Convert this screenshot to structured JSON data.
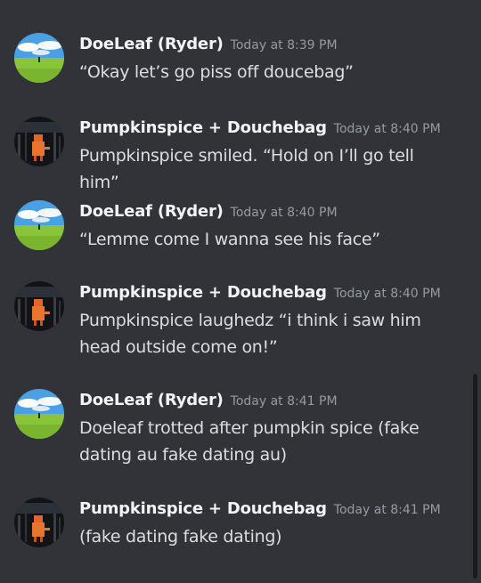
{
  "messages": [
    {
      "author": "DoeLeaf (Ryder)",
      "avatar_icon": "landscape-avatar-icon",
      "timestamp": "Today at 8:39 PM",
      "text": "“Okay let’s go piss off doucebag”"
    },
    {
      "author": "Pumpkinspice + Douchebag",
      "avatar_icon": "dark-cat-avatar-icon",
      "timestamp": "Today at 8:40 PM",
      "text": "Pumpkinspice smiled. “Hold on I’ll go tell him”"
    },
    {
      "author": "DoeLeaf (Ryder)",
      "avatar_icon": "landscape-avatar-icon",
      "timestamp": "Today at 8:40 PM",
      "text": "“Lemme come I wanna see his face”"
    },
    {
      "author": "Pumpkinspice + Douchebag",
      "avatar_icon": "dark-cat-avatar-icon",
      "timestamp": "Today at 8:40 PM",
      "text": "Pumpkinspice laughedz “i think i saw him head outside come on!”"
    },
    {
      "author": "DoeLeaf (Ryder)",
      "avatar_icon": "landscape-avatar-icon",
      "timestamp": "Today at 8:41 PM",
      "text": "Doeleaf trotted after pumpkin spice (fake dating au fake dating au)"
    },
    {
      "author": "Pumpkinspice + Douchebag",
      "avatar_icon": "dark-cat-avatar-icon",
      "timestamp": "Today at 8:41 PM",
      "text": "(fake dating fake dating)"
    }
  ],
  "colors": {
    "background": "#313338",
    "username": "#f2f3f5",
    "timestamp": "#949ba4",
    "message_text": "#dbdee1",
    "scrollbar": "#1a1b1e"
  }
}
